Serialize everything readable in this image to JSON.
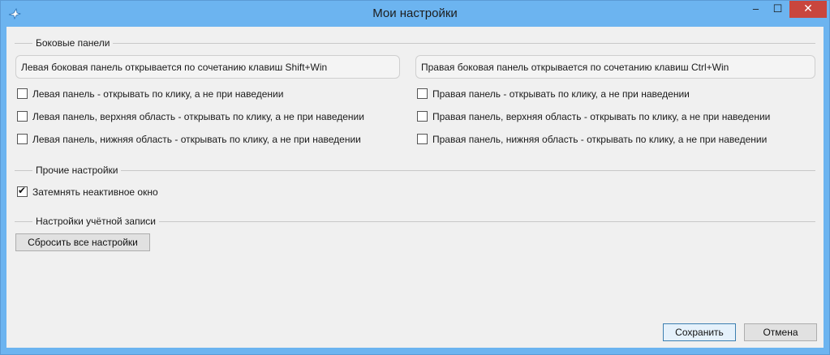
{
  "window": {
    "title": "Мои настройки",
    "controls": {
      "minimize": "‒",
      "maximize": "☐",
      "close": "✕"
    }
  },
  "side_panels": {
    "group_label": "Боковые панели",
    "left_info": "Левая боковая панель открывается по сочетанию клавиш Shift+Win",
    "right_info": "Правая боковая панель открывается по сочетанию клавиш Ctrl+Win",
    "left_options": [
      {
        "label": "Левая панель - открывать по клику, а не при наведении",
        "checked": false
      },
      {
        "label": "Левая панель, верхняя область - открывать по клику, а не при наведении",
        "checked": false
      },
      {
        "label": "Левая панель, нижняя область - открывать по клику, а не при наведении",
        "checked": false
      }
    ],
    "right_options": [
      {
        "label": "Правая панель - открывать по клику, а не при наведении",
        "checked": false
      },
      {
        "label": "Правая панель, верхняя область - открывать по клику, а не при наведении",
        "checked": false
      },
      {
        "label": "Правая панель, нижняя область - открывать по клику, а не при наведении",
        "checked": false
      }
    ]
  },
  "other_settings": {
    "group_label": "Прочие настройки",
    "dim_inactive": {
      "label": "Затемнять неактивное окно",
      "checked": true
    }
  },
  "account_settings": {
    "group_label": "Настройки учётной записи",
    "reset_button": "Сбросить все настройки"
  },
  "footer": {
    "save_button": "Сохранить",
    "cancel_button": "Отмена"
  },
  "colors": {
    "titlebar": "#6cb4f0",
    "close_button": "#c9463d",
    "client_bg": "#f0f0f0"
  }
}
